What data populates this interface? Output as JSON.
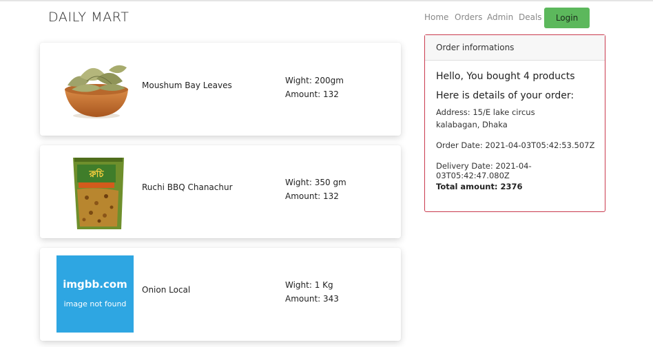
{
  "header": {
    "brand": "DAILY MART",
    "nav": [
      "Home",
      "Orders",
      "Admin",
      "Deals"
    ],
    "login_label": "Login"
  },
  "products": [
    {
      "name": "Moushum Bay Leaves",
      "weight": "Wight: 200gm",
      "amount": "Amount: 132",
      "image": "bay-leaves-bowl"
    },
    {
      "name": "Ruchi BBQ Chanachur",
      "weight": "Wight: 350 gm",
      "amount": "Amount: 132",
      "image": "chanachur-packet"
    },
    {
      "name": "Onion Local",
      "weight": "Wight: 1 Kg",
      "amount": "Amount: 343",
      "image": "imgbb-placeholder",
      "placeholder_title": "imgbb.com",
      "placeholder_sub": "image not found"
    }
  ],
  "order": {
    "header": "Order informations",
    "greeting": "Hello, You bought 4 products",
    "details_title": "Here is details of your order:",
    "address": "Address: 15/E lake circus kalabagan, Dhaka",
    "order_date": "Order Date: 2021-04-03T05:42:53.507Z",
    "delivery_date": "Delivery Date: 2021-04-03T05:42:47.080Z",
    "total": "Total amount: 2376"
  },
  "colors": {
    "login_button": "#5cb85c",
    "order_border": "#c9394d",
    "placeholder_bg": "#2ea6e2"
  }
}
